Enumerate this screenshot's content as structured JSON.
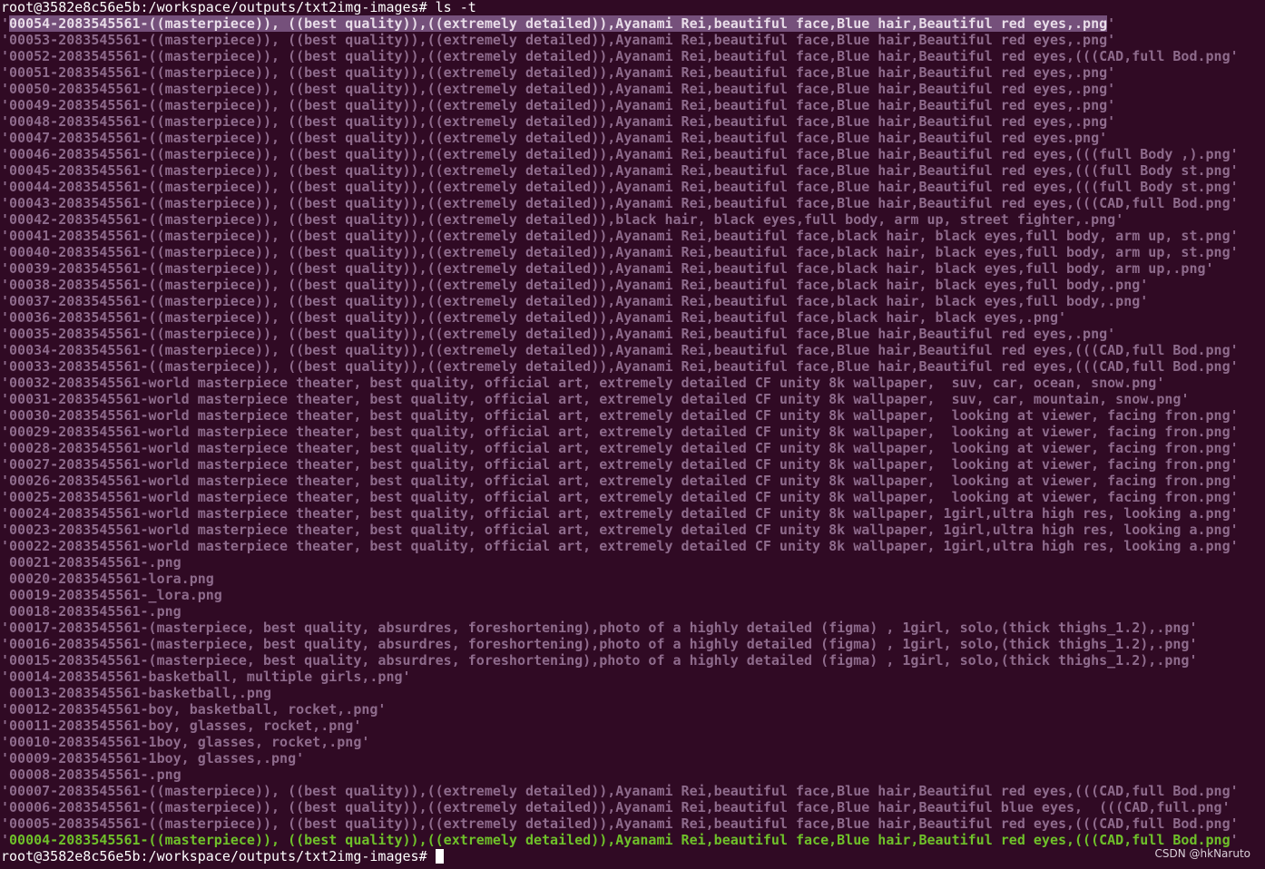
{
  "terminal": {
    "prompt": "root@3582e8c56e5b:/workspace/outputs/txt2img-images#",
    "command": " ls -t",
    "quote_char": "'",
    "files": [
      {
        "name": "00054-2083545561-((masterpiece)), ((best quality)),((extremely detailed)),Ayanami Rei,beautiful face,Blue hair,Beautiful red eyes,.png",
        "quoted": true,
        "selected": true
      },
      {
        "name": "00053-2083545561-((masterpiece)), ((best quality)),((extremely detailed)),Ayanami Rei,beautiful face,Blue hair,Beautiful red eyes,.png",
        "quoted": true
      },
      {
        "name": "00052-2083545561-((masterpiece)), ((best quality)),((extremely detailed)),Ayanami Rei,beautiful face,Blue hair,Beautiful red eyes,(((CAD,full Bod.png",
        "quoted": true
      },
      {
        "name": "00051-2083545561-((masterpiece)), ((best quality)),((extremely detailed)),Ayanami Rei,beautiful face,Blue hair,Beautiful red eyes,.png",
        "quoted": true
      },
      {
        "name": "00050-2083545561-((masterpiece)), ((best quality)),((extremely detailed)),Ayanami Rei,beautiful face,Blue hair,Beautiful red eyes,.png",
        "quoted": true
      },
      {
        "name": "00049-2083545561-((masterpiece)), ((best quality)),((extremely detailed)),Ayanami Rei,beautiful face,Blue hair,Beautiful red eyes,.png",
        "quoted": true
      },
      {
        "name": "00048-2083545561-((masterpiece)), ((best quality)),((extremely detailed)),Ayanami Rei,beautiful face,Blue hair,Beautiful red eyes,.png",
        "quoted": true
      },
      {
        "name": "00047-2083545561-((masterpiece)), ((best quality)),((extremely detailed)),Ayanami Rei,beautiful face,Blue hair,Beautiful red eyes.png",
        "quoted": true
      },
      {
        "name": "00046-2083545561-((masterpiece)), ((best quality)),((extremely detailed)),Ayanami Rei,beautiful face,Blue hair,Beautiful red eyes,(((full Body ,).png",
        "quoted": true
      },
      {
        "name": "00045-2083545561-((masterpiece)), ((best quality)),((extremely detailed)),Ayanami Rei,beautiful face,Blue hair,Beautiful red eyes,(((full Body st.png",
        "quoted": true
      },
      {
        "name": "00044-2083545561-((masterpiece)), ((best quality)),((extremely detailed)),Ayanami Rei,beautiful face,Blue hair,Beautiful red eyes,(((full Body st.png",
        "quoted": true
      },
      {
        "name": "00043-2083545561-((masterpiece)), ((best quality)),((extremely detailed)),Ayanami Rei,beautiful face,Blue hair,Beautiful red eyes,(((CAD,full Bod.png",
        "quoted": true
      },
      {
        "name": "00042-2083545561-((masterpiece)), ((best quality)),((extremely detailed)),black hair, black eyes,full body, arm up, street fighter,.png",
        "quoted": true
      },
      {
        "name": "00041-2083545561-((masterpiece)), ((best quality)),((extremely detailed)),Ayanami Rei,beautiful face,black hair, black eyes,full body, arm up, st.png",
        "quoted": true
      },
      {
        "name": "00040-2083545561-((masterpiece)), ((best quality)),((extremely detailed)),Ayanami Rei,beautiful face,black hair, black eyes,full body, arm up, st.png",
        "quoted": true
      },
      {
        "name": "00039-2083545561-((masterpiece)), ((best quality)),((extremely detailed)),Ayanami Rei,beautiful face,black hair, black eyes,full body, arm up,.png",
        "quoted": true
      },
      {
        "name": "00038-2083545561-((masterpiece)), ((best quality)),((extremely detailed)),Ayanami Rei,beautiful face,black hair, black eyes,full body,.png",
        "quoted": true
      },
      {
        "name": "00037-2083545561-((masterpiece)), ((best quality)),((extremely detailed)),Ayanami Rei,beautiful face,black hair, black eyes,full body,.png",
        "quoted": true
      },
      {
        "name": "00036-2083545561-((masterpiece)), ((best quality)),((extremely detailed)),Ayanami Rei,beautiful face,black hair, black eyes,.png",
        "quoted": true
      },
      {
        "name": "00035-2083545561-((masterpiece)), ((best quality)),((extremely detailed)),Ayanami Rei,beautiful face,Blue hair,Beautiful red eyes,.png",
        "quoted": true
      },
      {
        "name": "00034-2083545561-((masterpiece)), ((best quality)),((extremely detailed)),Ayanami Rei,beautiful face,Blue hair,Beautiful red eyes,(((CAD,full Bod.png",
        "quoted": true
      },
      {
        "name": "00033-2083545561-((masterpiece)), ((best quality)),((extremely detailed)),Ayanami Rei,beautiful face,Blue hair,Beautiful red eyes,(((CAD,full Bod.png",
        "quoted": true
      },
      {
        "name": "00032-2083545561-world masterpiece theater, best quality, official art, extremely detailed CF unity 8k wallpaper,  suv, car, ocean, snow.png",
        "quoted": true
      },
      {
        "name": "00031-2083545561-world masterpiece theater, best quality, official art, extremely detailed CF unity 8k wallpaper,  suv, car, mountain, snow.png",
        "quoted": true
      },
      {
        "name": "00030-2083545561-world masterpiece theater, best quality, official art, extremely detailed CF unity 8k wallpaper,  looking at viewer, facing fron.png",
        "quoted": true
      },
      {
        "name": "00029-2083545561-world masterpiece theater, best quality, official art, extremely detailed CF unity 8k wallpaper,  looking at viewer, facing fron.png",
        "quoted": true
      },
      {
        "name": "00028-2083545561-world masterpiece theater, best quality, official art, extremely detailed CF unity 8k wallpaper,  looking at viewer, facing fron.png",
        "quoted": true
      },
      {
        "name": "00027-2083545561-world masterpiece theater, best quality, official art, extremely detailed CF unity 8k wallpaper,  looking at viewer, facing fron.png",
        "quoted": true
      },
      {
        "name": "00026-2083545561-world masterpiece theater, best quality, official art, extremely detailed CF unity 8k wallpaper,  looking at viewer, facing fron.png",
        "quoted": true
      },
      {
        "name": "00025-2083545561-world masterpiece theater, best quality, official art, extremely detailed CF unity 8k wallpaper,  looking at viewer, facing fron.png",
        "quoted": true
      },
      {
        "name": "00024-2083545561-world masterpiece theater, best quality, official art, extremely detailed CF unity 8k wallpaper, 1girl,ultra high res, looking a.png",
        "quoted": true
      },
      {
        "name": "00023-2083545561-world masterpiece theater, best quality, official art, extremely detailed CF unity 8k wallpaper, 1girl,ultra high res, looking a.png",
        "quoted": true
      },
      {
        "name": "00022-2083545561-world masterpiece theater, best quality, official art, extremely detailed CF unity 8k wallpaper, 1girl,ultra high res, looking a.png",
        "quoted": true
      },
      {
        "name": "00021-2083545561-.png",
        "quoted": false
      },
      {
        "name": "00020-2083545561-lora.png",
        "quoted": false
      },
      {
        "name": "00019-2083545561-_lora.png",
        "quoted": false
      },
      {
        "name": "00018-2083545561-.png",
        "quoted": false
      },
      {
        "name": "00017-2083545561-(masterpiece, best quality, absurdres, foreshortening),photo of a highly detailed (figma) , 1girl, solo,(thick thighs_1.2),.png",
        "quoted": true
      },
      {
        "name": "00016-2083545561-(masterpiece, best quality, absurdres, foreshortening),photo of a highly detailed (figma) , 1girl, solo,(thick thighs_1.2),.png",
        "quoted": true
      },
      {
        "name": "00015-2083545561-(masterpiece, best quality, absurdres, foreshortening),photo of a highly detailed (figma) , 1girl, solo,(thick thighs_1.2),.png",
        "quoted": true
      },
      {
        "name": "00014-2083545561-basketball, multiple girls,.png",
        "quoted": true
      },
      {
        "name": "00013-2083545561-basketball,.png",
        "quoted": false
      },
      {
        "name": "00012-2083545561-boy, basketball, rocket,.png",
        "quoted": true
      },
      {
        "name": "00011-2083545561-boy, glasses, rocket,.png",
        "quoted": true
      },
      {
        "name": "00010-2083545561-1boy, glasses, rocket,.png",
        "quoted": true
      },
      {
        "name": "00009-2083545561-1boy, glasses,.png",
        "quoted": true
      },
      {
        "name": "00008-2083545561-.png",
        "quoted": false
      },
      {
        "name": "00007-2083545561-((masterpiece)), ((best quality)),((extremely detailed)),Ayanami Rei,beautiful face,Blue hair,Beautiful red eyes,(((CAD,full Bod.png",
        "quoted": true
      },
      {
        "name": "00006-2083545561-((masterpiece)), ((best quality)),((extremely detailed)),Ayanami Rei,beautiful face,Blue hair,Beautiful blue eyes,  (((CAD,full.png",
        "quoted": true
      },
      {
        "name": "00005-2083545561-((masterpiece)), ((best quality)),((extremely detailed)),Ayanami Rei,beautiful face,Blue hair,Beautiful red eyes,(((CAD,full Bod.png",
        "quoted": true
      },
      {
        "name": "00004-2083545561-((masterpiece)), ((best quality)),((extremely detailed)),Ayanami Rei,beautiful face,Blue hair,Beautiful red eyes,(((CAD,full Bod.png",
        "quoted": true,
        "exec": true
      }
    ]
  },
  "watermark": "CSDN @hkNaruto",
  "colors": {
    "background": "#300a24",
    "file": "#8e6b8c",
    "selection": "#75507b",
    "executable": "#6fc12a",
    "text": "#ffffff"
  }
}
